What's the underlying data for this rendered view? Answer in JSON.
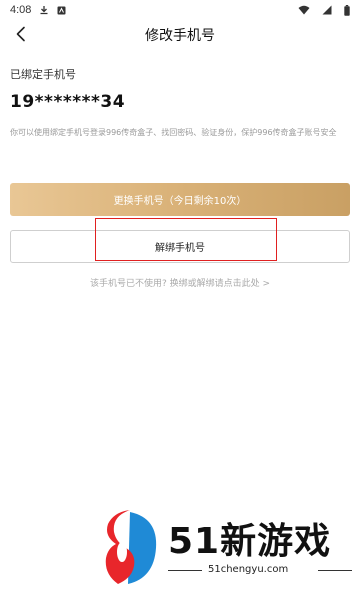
{
  "status_bar": {
    "time": "4:08",
    "icons": [
      "download-icon",
      "app-icon",
      "wifi-icon",
      "signal-icon",
      "battery-icon"
    ]
  },
  "nav": {
    "title": "修改手机号",
    "back_icon": "chevron-left-icon"
  },
  "bound": {
    "label": "已绑定手机号",
    "number": "19*******34",
    "description": "你可以使用绑定手机号登录996传奇盒子、找回密码、验证身份，保护996传奇盒子账号安全"
  },
  "buttons": {
    "change_label": "更换手机号（今日剩余10次）",
    "unbind_label": "解绑手机号"
  },
  "help": {
    "text": "该手机号已不使用? 换绑或解绑请点击此处 >"
  },
  "watermark": {
    "brand": "51新游戏",
    "url": "51chengyu.com"
  },
  "colors": {
    "change_gradient_start": "#e9c795",
    "change_gradient_end": "#c9a064",
    "highlight": "#e02020",
    "logo_red": "#e8262b",
    "logo_blue": "#1f8ad6"
  }
}
